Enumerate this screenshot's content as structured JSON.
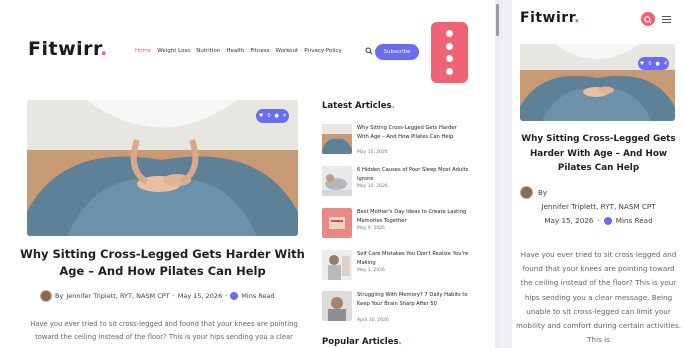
{
  "brand": {
    "name": "Fitwirr",
    "accent": "#f06374",
    "purple": "#6a6df0"
  },
  "nav": {
    "items": [
      "Home",
      "Weight Loss",
      "Nutrition",
      "Health",
      "Fitness",
      "Workout",
      "Privacy Policy"
    ],
    "subscribe_label": "Subscribe"
  },
  "social": [
    "facebook-icon",
    "instagram-icon",
    "instagram-icon",
    "twitter-icon"
  ],
  "post": {
    "title": "Why Sitting Cross-Legged Gets Harder With Age – And How Pilates Can Help",
    "by": "By",
    "author": "Jennifer Triplett, RYT, NASM CPT",
    "date": "May 15, 2026",
    "read_time": "Mins Read",
    "hero_counts": {
      "likes": "0",
      "comments": "4"
    },
    "excerpt_desktop": "Have you ever tried to sit cross-legged and found that your knees are pointing toward the ceiling instead of the floor? This is your hips sending you a clear",
    "excerpt_mobile": "Have you ever tried to sit cross-legged and found that your knees are pointing toward the ceiling instead of the floor? This is your hips sending you a clear message. Being unable to sit cross-legged can limit your mobility and comfort during certain activities. This is"
  },
  "sidebar": {
    "latest_heading": "Latest Articles",
    "popular_heading": "Popular Articles",
    "latest": [
      {
        "title": "Why Sitting Cross-Legged Gets Harder With Age – And How Pilates Can Help",
        "date": "May 15, 2026"
      },
      {
        "title": "6 Hidden Causes of Poor Sleep Most Adults Ignore",
        "date": "May 10, 2026"
      },
      {
        "title": "Best Mother's Day Ideas to Create Lasting Memories Together",
        "date": "May 9, 2026"
      },
      {
        "title": "Self Care Mistakes You Don't Realize You're Making",
        "date": "May 1, 2026"
      },
      {
        "title": "Struggling With Memory? 7 Daily Habits to Keep Your Brain Sharp After 50",
        "date": "April 30, 2026"
      }
    ]
  }
}
